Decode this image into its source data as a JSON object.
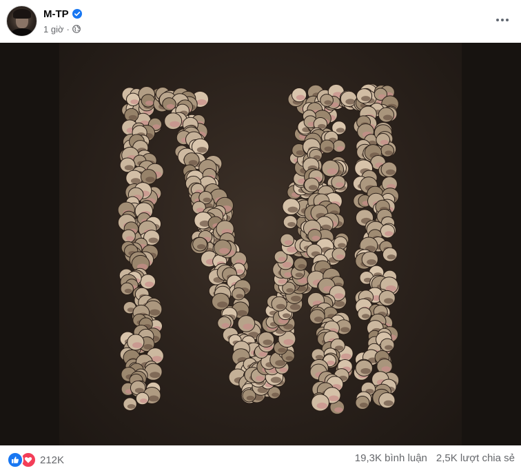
{
  "post": {
    "author": "M-TP",
    "timestamp": "1 giờ",
    "separator": "·",
    "privacy_icon": "globe-icon",
    "verified_icon": "verified-badge-icon",
    "more_icon": "more-horizontal-icon",
    "image_description_icon": "photo"
  },
  "stats": {
    "reaction_icons": [
      "like-icon",
      "love-icon"
    ],
    "reaction_count": "212K",
    "comments": "19,3K bình luận",
    "shares": "2,5K lượt chia sẻ"
  },
  "colors": {
    "like": "#1877f2",
    "love": "#f33e58",
    "verified": "#1877f2",
    "secondary_text": "#65676b"
  }
}
